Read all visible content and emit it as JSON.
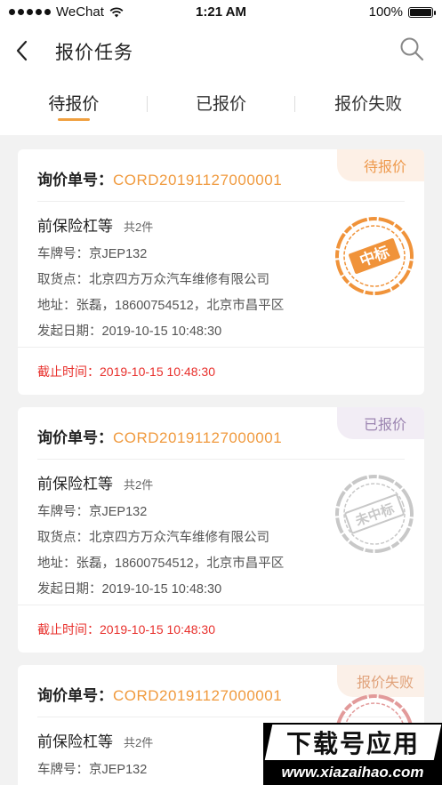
{
  "status_bar": {
    "carrier": "WeChat",
    "time": "1:21 AM",
    "battery": "100%",
    "battery_level": 1.0
  },
  "nav": {
    "title": "报价任务",
    "back_icon": "chevron-left-icon",
    "search_icon": "search-icon"
  },
  "tabs": [
    {
      "label": "待报价",
      "active": true
    },
    {
      "label": "已报价",
      "active": false
    },
    {
      "label": "报价失败",
      "active": false
    }
  ],
  "cards": [
    {
      "badge": "待报价",
      "order_label": "询价单号：",
      "order_no": "CORD20191127000001",
      "part_name": "前保险杠等",
      "part_count": "共2件",
      "plate": "车牌号：京JEP132",
      "pickup": "取货点：北京四方万众汽车维修有限公司",
      "address": "地址：张磊，18600754512，北京市昌平区",
      "start_date": "发起日期：2019-10-15 10:48:30",
      "deadline": "截止时间：2019-10-15 10:48:30",
      "stamp": "中标",
      "stamp_color": "#f0933a"
    },
    {
      "badge": "已报价",
      "order_label": "询价单号：",
      "order_no": "CORD20191127000001",
      "part_name": "前保险杠等",
      "part_count": "共2件",
      "plate": "车牌号：京JEP132",
      "pickup": "取货点：北京四方万众汽车维修有限公司",
      "address": "地址：张磊，18600754512，北京市昌平区",
      "start_date": "发起日期：2019-10-15 10:48:30",
      "deadline": "截止时间：2019-10-15 10:48:30",
      "stamp": "未中标",
      "stamp_color": "#c8c8c8"
    },
    {
      "badge": "报价失败",
      "order_label": "询价单号：",
      "order_no": "CORD20191127000001",
      "part_name": "前保险杠等",
      "part_count": "共2件",
      "plate": "车牌号：京JEP132",
      "stamp_color": "#e29a9a"
    }
  ],
  "watermark": {
    "top": "下载号应用",
    "bottom": "www.xiazaihao.com"
  }
}
